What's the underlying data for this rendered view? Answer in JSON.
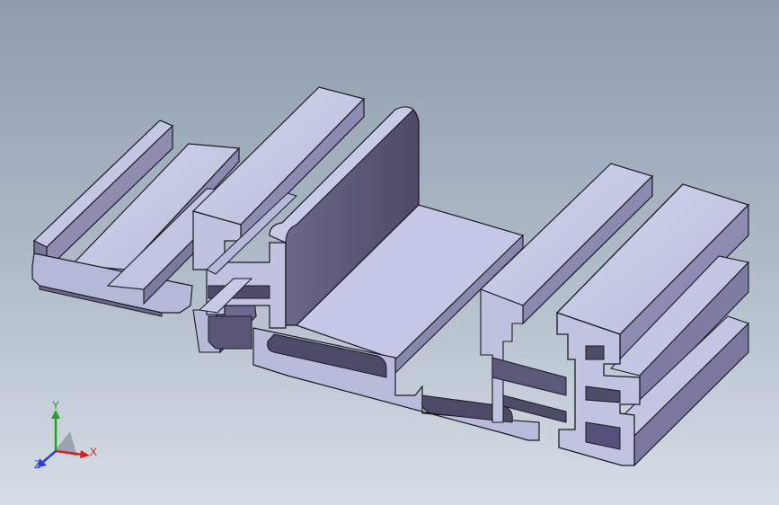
{
  "viewport": {
    "model": "aluminium-extrusion-profile"
  },
  "colors": {
    "bg_top": "#8f9cad",
    "bg_bottom": "#d6dde6",
    "face_light": "#c9cde4",
    "face_mid": "#a9aed0",
    "face_dark": "#5d5a78",
    "face_deep": "#4a4762",
    "edge": "#1b1a24",
    "axis_x": "#d21f1f",
    "axis_y": "#22a322",
    "axis_z": "#2b3fd0"
  },
  "triad": {
    "x_label": "X",
    "y_label": "Y",
    "z_label": "Z"
  }
}
